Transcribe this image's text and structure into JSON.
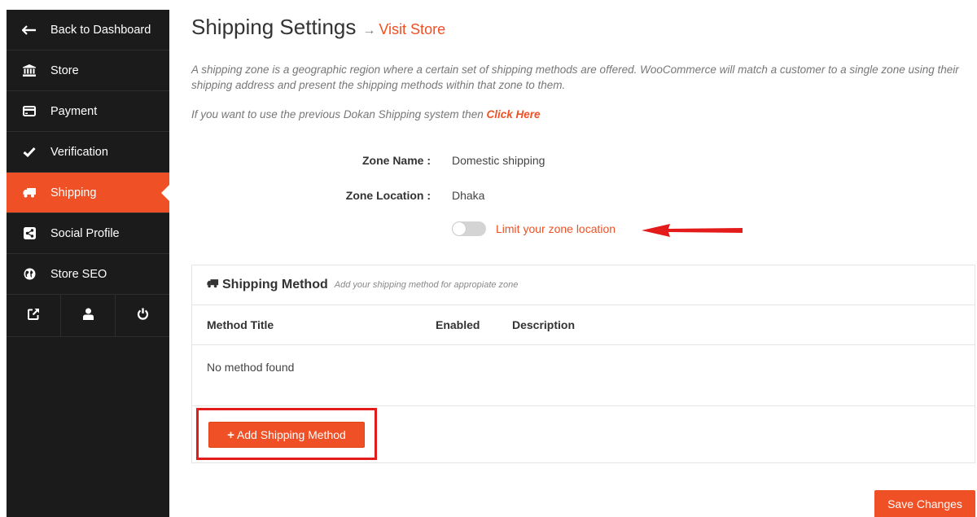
{
  "sidebar": {
    "items": [
      {
        "label": "Back to Dashboard",
        "icon": "arrow-left-icon"
      },
      {
        "label": "Store",
        "icon": "bank-icon"
      },
      {
        "label": "Payment",
        "icon": "credit-card-icon"
      },
      {
        "label": "Verification",
        "icon": "check-icon"
      },
      {
        "label": "Shipping",
        "icon": "truck-icon",
        "active": true
      },
      {
        "label": "Social Profile",
        "icon": "share-icon"
      },
      {
        "label": "Store SEO",
        "icon": "globe-icon"
      }
    ],
    "bottom_icons": [
      "external-link-icon",
      "user-icon",
      "power-icon"
    ]
  },
  "header": {
    "title": "Shipping Settings",
    "arrow": "→",
    "visit_store": "Visit Store"
  },
  "intro": "A shipping zone is a geographic region where a certain set of shipping methods are offered. WooCommerce will match a customer to a single zone using their shipping address and present the shipping methods within that zone to them.",
  "prev_note": {
    "text": "If you want to use the previous Dokan Shipping system then ",
    "link": "Click Here"
  },
  "zone": {
    "name_label": "Zone Name :",
    "name_value": "Domestic shipping",
    "location_label": "Zone Location :",
    "location_value": "Dhaka",
    "limit_label": "Limit your zone location",
    "limit_enabled": false
  },
  "shipping_method": {
    "title": "Shipping Method",
    "subtitle": "Add your shipping method for appropiate zone",
    "columns": [
      "Method Title",
      "Enabled",
      "Description"
    ],
    "empty_text": "No method found",
    "add_label": "Add Shipping Method",
    "add_plus": "+"
  },
  "save_label": "Save Changes",
  "colors": {
    "accent": "#f05025",
    "sidebar_bg": "#1b1b1b",
    "annotation": "#e41b1b"
  }
}
